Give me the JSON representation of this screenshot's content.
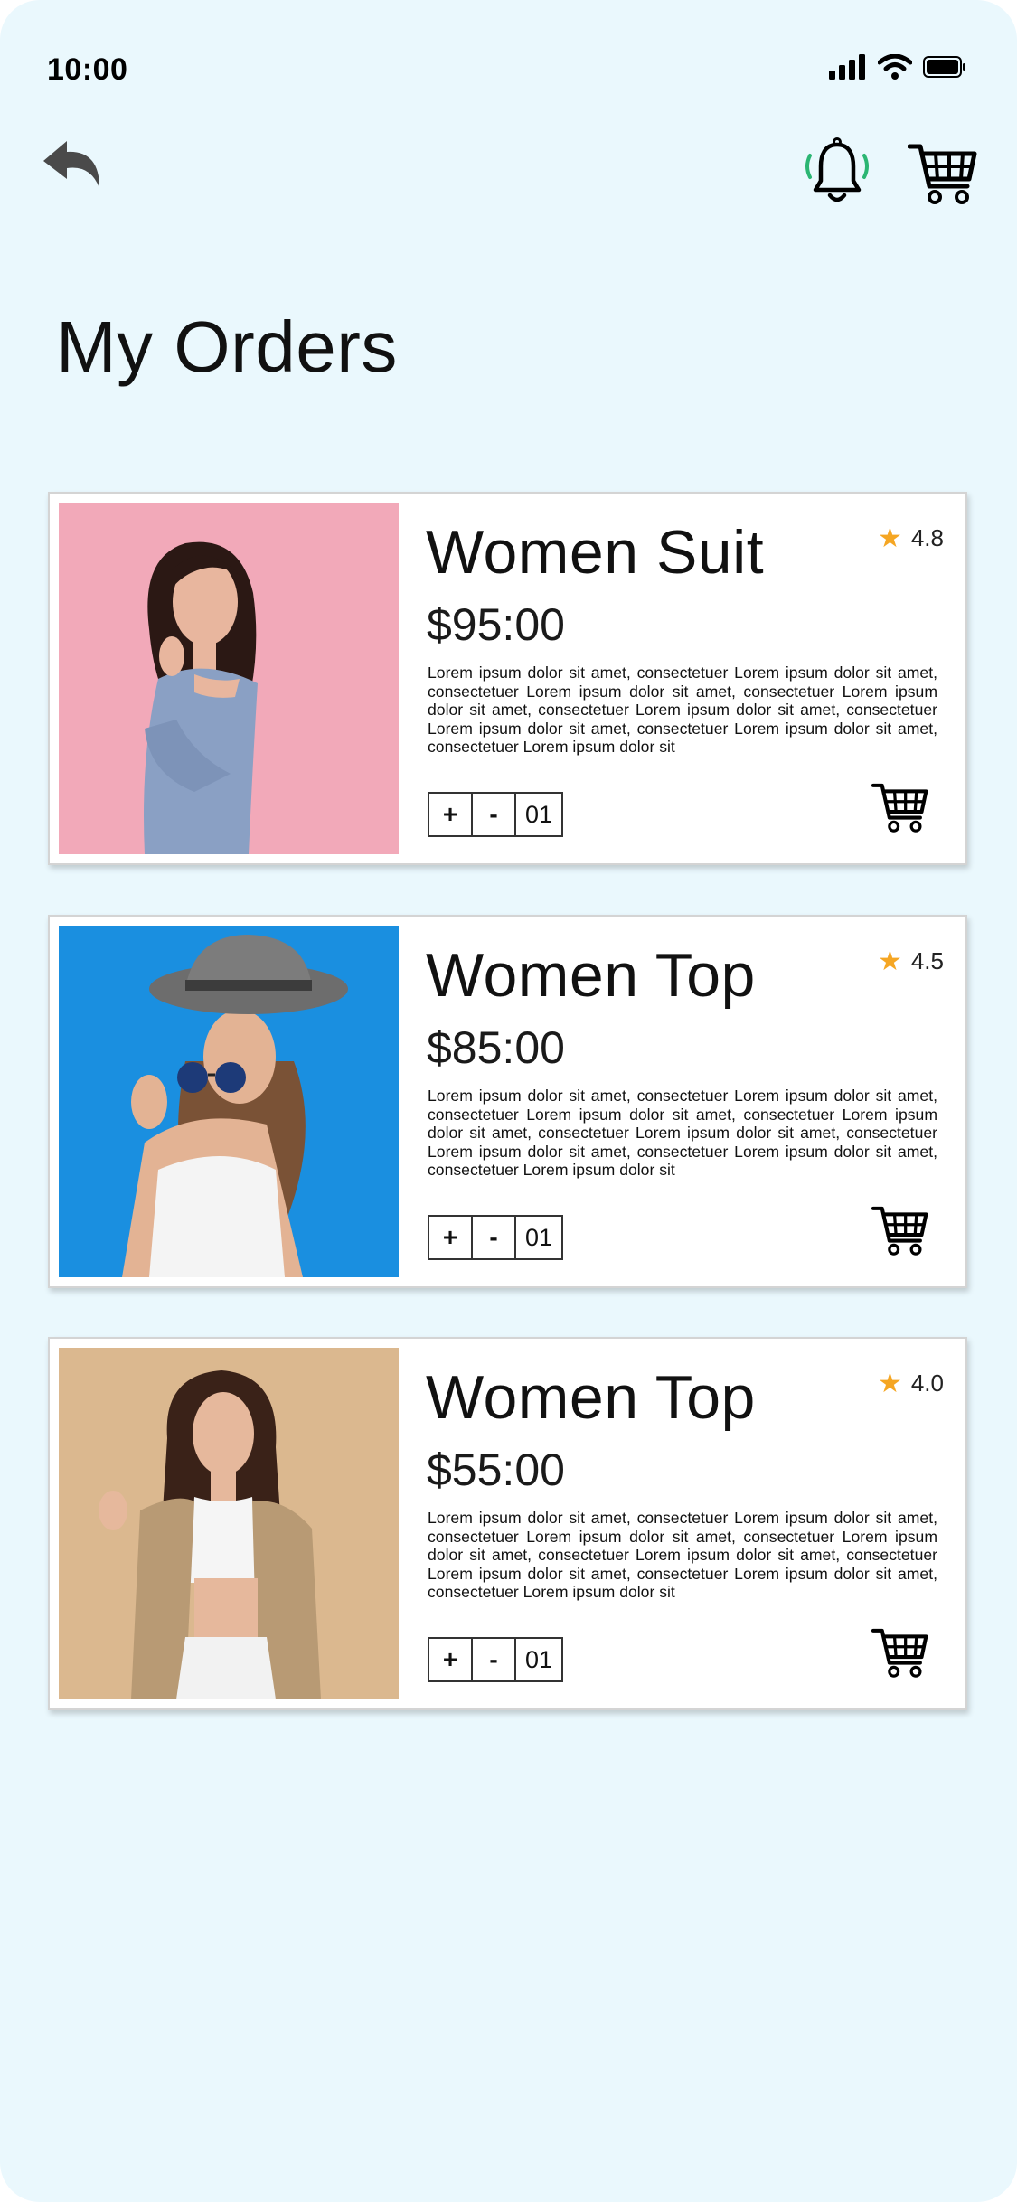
{
  "status_bar": {
    "time": "10:00"
  },
  "header": {
    "back_icon": "back-arrow-icon",
    "bell_icon": "notification-bell-icon",
    "cart_icon": "shopping-cart-icon"
  },
  "page": {
    "title": "My Orders"
  },
  "colors": {
    "background": "#eaf8fd",
    "card": "#ffffff",
    "star": "#f5a623",
    "bell_ring": "#2bb673"
  },
  "orders": [
    {
      "name": "Women Suit",
      "price": "$95:00",
      "rating": "4.8",
      "description": "Lorem ipsum dolor sit amet, consectetuer Lorem ipsum dolor sit amet, consectetuer Lorem ipsum dolor sit amet, consectetuer Lorem ipsum dolor sit amet, consectetuer Lorem ipsum dolor sit amet, consectetuer Lorem ipsum dolor sit amet, consectetuer Lorem ipsum dolor sit amet, consectetuer Lorem ipsum dolor sit",
      "qty_plus": "+",
      "qty_minus": "-",
      "quantity": "01",
      "photo_background": "#f2a9b9"
    },
    {
      "name": "Women Top",
      "price": "$85:00",
      "rating": "4.5",
      "description": "Lorem ipsum dolor sit amet, consectetuer Lorem ipsum dolor sit amet, consectetuer Lorem ipsum dolor sit amet, consectetuer Lorem ipsum dolor sit amet, consectetuer Lorem ipsum dolor sit amet, consectetuer Lorem ipsum dolor sit amet, consectetuer Lorem ipsum dolor sit amet, consectetuer Lorem ipsum dolor sit",
      "qty_plus": "+",
      "qty_minus": "-",
      "quantity": "01",
      "photo_background": "#1a8fe0"
    },
    {
      "name": "Women Top",
      "price": "$55:00",
      "rating": "4.0",
      "description": "Lorem ipsum dolor sit amet, consectetuer Lorem ipsum dolor sit amet, consectetuer Lorem ipsum dolor sit amet, consectetuer Lorem ipsum dolor sit amet, consectetuer Lorem ipsum dolor sit amet, consectetuer Lorem ipsum dolor sit amet, consectetuer Lorem ipsum dolor sit amet, consectetuer Lorem ipsum dolor sit",
      "qty_plus": "+",
      "qty_minus": "-",
      "quantity": "01",
      "photo_background": "#dbb88f"
    }
  ]
}
